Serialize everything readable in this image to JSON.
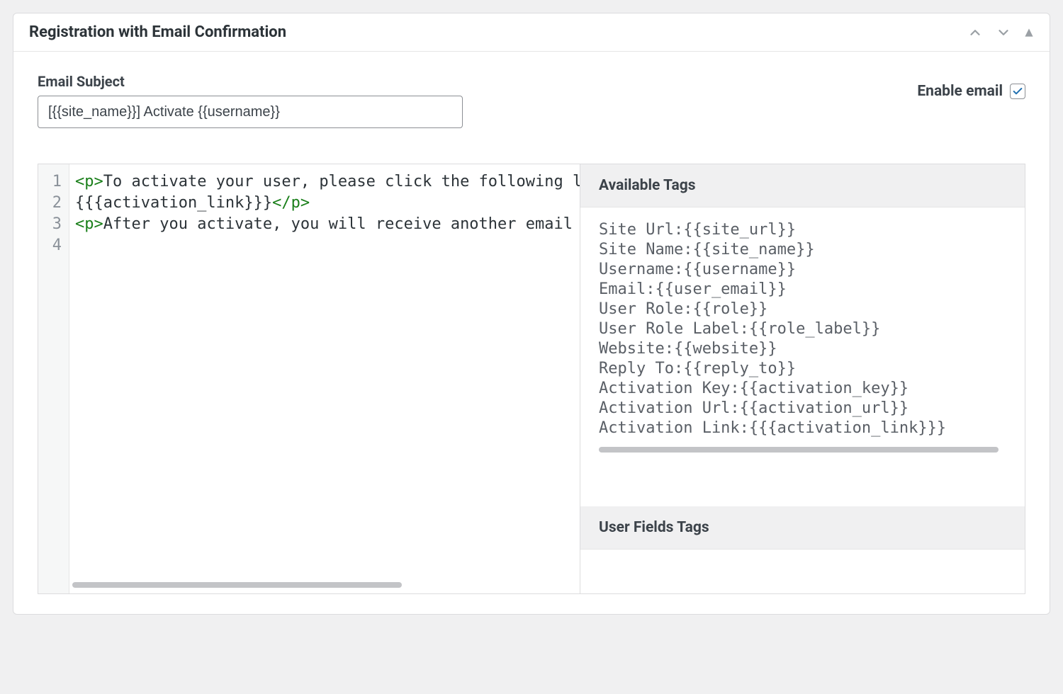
{
  "panel": {
    "title": "Registration with Email Confirmation"
  },
  "subject": {
    "label": "Email Subject",
    "value": "[{{site_name}}] Activate {{username}}"
  },
  "enable": {
    "label": "Enable email",
    "checked": true
  },
  "code": {
    "line_numbers": [
      "1",
      "2",
      "3",
      "4"
    ],
    "l1_tag_open": "<p>",
    "l1_text": "To activate your user, please click the following lin",
    "l2_text": "{{{activation_link}}}",
    "l2_tag_close": "</p>",
    "l3_tag_open": "<p>",
    "l3_text": "After you activate, you will receive another email wi",
    "l4_text": ""
  },
  "side": {
    "available_header": "Available Tags",
    "userfields_header": "User Fields Tags",
    "tags": [
      "Site Url:{{site_url}}",
      "Site Name:{{site_name}}",
      "Username:{{username}}",
      "Email:{{user_email}}",
      "User Role:{{role}}",
      "User Role Label:{{role_label}}",
      "Website:{{website}}",
      "Reply To:{{reply_to}}",
      "Activation Key:{{activation_key}}",
      "Activation Url:{{activation_url}}",
      "Activation Link:{{{activation_link}}}"
    ]
  }
}
